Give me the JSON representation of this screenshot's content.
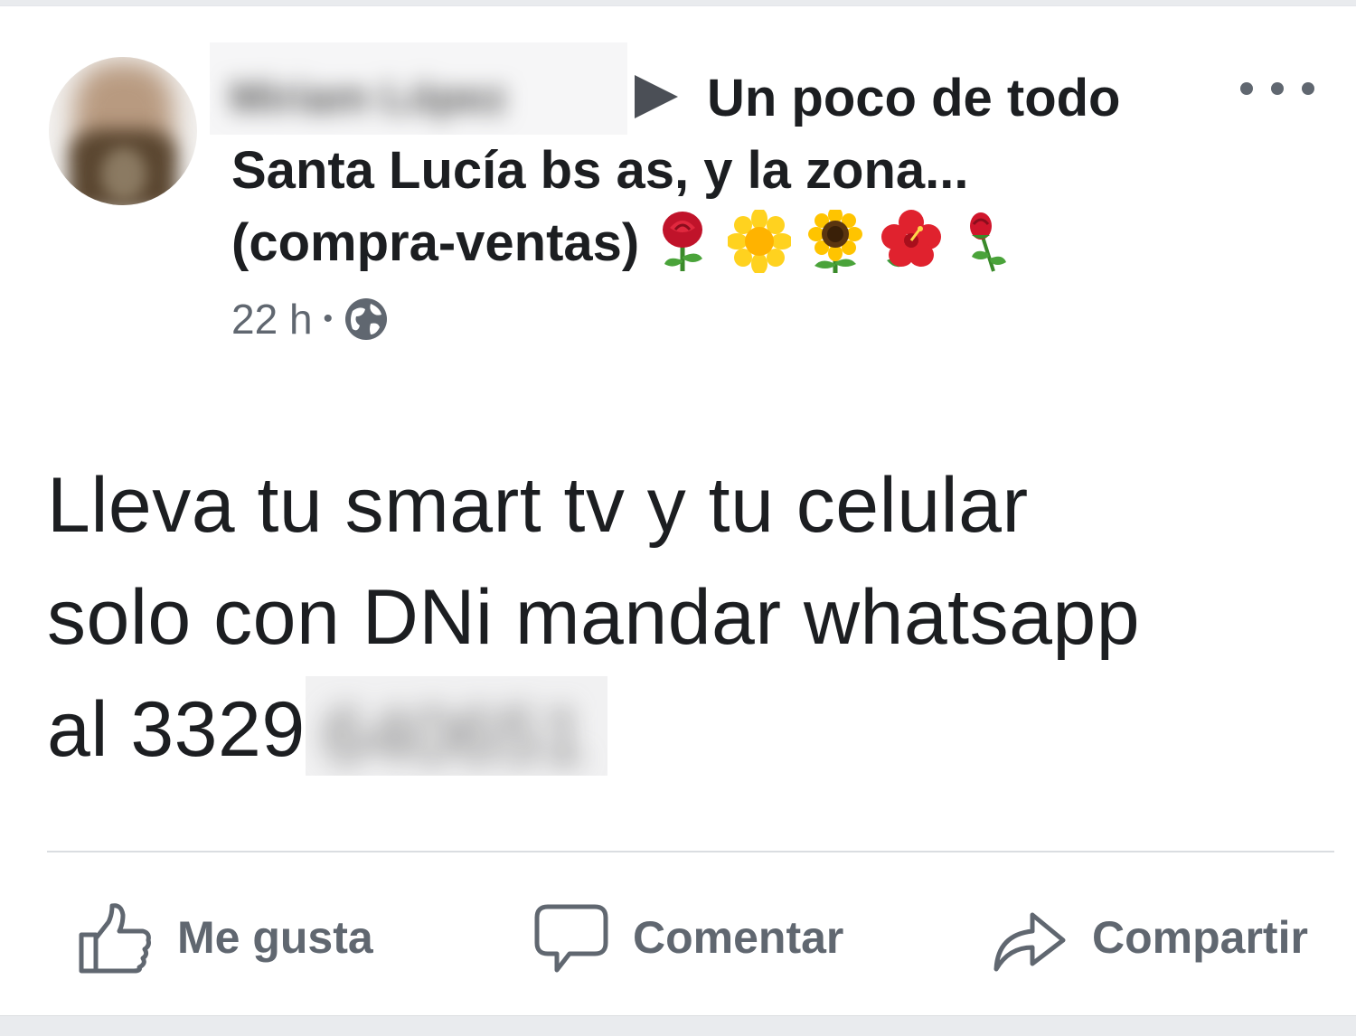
{
  "post": {
    "author_name_redacted": "Miriam López",
    "group_title_line1": "Un poco de todo",
    "group_title_line2": "Santa Lucía bs as, y la zona...",
    "group_title_line3": "(compra-ventas)",
    "title_emojis": [
      "rose-icon",
      "blossom-icon",
      "sunflower-icon",
      "hibiscus-icon",
      "rosebud-icon"
    ],
    "time": "22 h",
    "separator": "•",
    "privacy_icon": "globe-icon",
    "more_icon": "more-options-icon",
    "text_line1": "Lleva tu smart tv y tu celular",
    "text_line2": "solo con DNi mandar whatsapp",
    "text_line3_prefix": "al 3329",
    "text_line3_redacted": "640651"
  },
  "actions": {
    "like_label": "Me gusta",
    "comment_label": "Comentar",
    "share_label": "Compartir"
  },
  "colors": {
    "text_primary": "#1c1e21",
    "text_secondary": "#606770",
    "divider": "#dadde1",
    "background": "#e9ebee"
  }
}
